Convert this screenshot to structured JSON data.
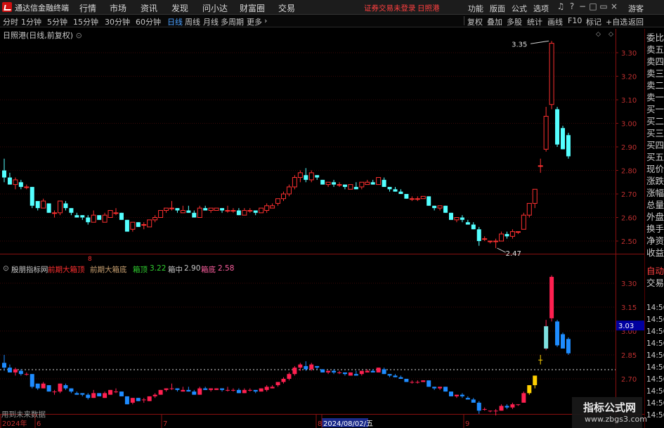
{
  "app": {
    "title": "通达信金融终端",
    "menu": [
      "行情",
      "市场",
      "资讯",
      "发现",
      "问小达",
      "财富圈",
      "交易"
    ],
    "status": "证券交易未登录",
    "stock": "日照港",
    "right_menu": [
      "功能",
      "版面",
      "公式",
      "选项"
    ],
    "guest": "游客"
  },
  "periods": [
    "分时",
    "1分钟",
    "5分钟",
    "15分钟",
    "30分钟",
    "60分钟",
    "日线",
    "周线",
    "月线",
    "多周期",
    "更多"
  ],
  "active_period": "日线",
  "toolbar": [
    "复权",
    "叠加",
    "多股",
    "统计",
    "画线",
    "F10",
    "标记",
    "+自选",
    "返回"
  ],
  "chart_title": "日照港(日线,前复权)",
  "indicator": {
    "name": "殷朋指标网",
    "prev_top_label": "前期大箱顶",
    "prev_bot_label": "前期大箱底",
    "top_label": "箱顶",
    "top_value": "3.22",
    "mid_label": "箱中",
    "mid_value": "2.90",
    "bot_label": "箱底",
    "bot_value": "2.58"
  },
  "right_panel": [
    "委比",
    "卖五",
    "卖四",
    "卖三",
    "卖二",
    "卖一",
    "买一",
    "买二",
    "买三",
    "买四",
    "买五",
    "现价",
    "涨跌",
    "涨幅",
    "总量",
    "外盘",
    "换手",
    "净资",
    "收益",
    "自动",
    "交易",
    "14:56",
    "14:56",
    "14:56",
    "14:56",
    "14:56",
    "14:56",
    "14:56",
    "14:56",
    "14:56",
    "14:56"
  ],
  "price_axis": [
    "3.30",
    "3.20",
    "3.10",
    "3.00",
    "2.90",
    "2.80",
    "2.70",
    "2.60",
    "2.50"
  ],
  "ind_axis": [
    "3.30",
    "3.15",
    "3.00",
    "2.85",
    "2.70"
  ],
  "ind_current": "3.03",
  "high_mark": "3.35",
  "low_mark": "2.47",
  "date_axis": [
    "2024年",
    "6",
    "7",
    "8",
    "2024/08/02/五",
    "9"
  ],
  "date_marker": "8",
  "footnote": "用到未来数据",
  "watermark": [
    "指标公式网",
    "www.zbgs3.com"
  ],
  "colors": {
    "up": "#ff3030",
    "down": "#54ffff",
    "accent": "#4aa0ff",
    "indicator_down": "#1e8cff",
    "indicator_yellow": "#ffd000"
  },
  "chart_data": {
    "type": "candlestick",
    "title": "日照港(日线,前复权)",
    "ylim": [
      2.44,
      3.4
    ],
    "ohlc": [
      [
        2.8,
        2.85,
        2.75,
        2.77
      ],
      [
        2.77,
        2.79,
        2.74,
        2.74
      ],
      [
        2.74,
        2.77,
        2.72,
        2.76
      ],
      [
        2.75,
        2.76,
        2.72,
        2.73
      ],
      [
        2.73,
        2.74,
        2.72,
        2.73
      ],
      [
        2.73,
        2.73,
        2.64,
        2.65
      ],
      [
        2.67,
        2.67,
        2.63,
        2.64
      ],
      [
        2.64,
        2.68,
        2.64,
        2.67
      ],
      [
        2.66,
        2.66,
        2.62,
        2.62
      ],
      [
        2.62,
        2.63,
        2.6,
        2.62
      ],
      [
        2.62,
        2.67,
        2.61,
        2.67
      ],
      [
        2.66,
        2.67,
        2.63,
        2.64
      ],
      [
        2.64,
        2.64,
        2.61,
        2.62
      ],
      [
        2.61,
        2.62,
        2.6,
        2.6
      ],
      [
        2.61,
        2.61,
        2.59,
        2.6
      ],
      [
        2.6,
        2.61,
        2.57,
        2.58
      ],
      [
        2.58,
        2.63,
        2.58,
        2.61
      ],
      [
        2.61,
        2.61,
        2.59,
        2.59
      ],
      [
        2.58,
        2.62,
        2.58,
        2.61
      ],
      [
        2.6,
        2.63,
        2.6,
        2.63
      ],
      [
        2.62,
        2.64,
        2.61,
        2.62
      ],
      [
        2.62,
        2.62,
        2.59,
        2.59
      ],
      [
        2.59,
        2.59,
        2.54,
        2.54
      ],
      [
        2.55,
        2.58,
        2.54,
        2.58
      ],
      [
        2.58,
        2.58,
        2.56,
        2.56
      ],
      [
        2.57,
        2.58,
        2.55,
        2.57
      ],
      [
        2.56,
        2.59,
        2.56,
        2.59
      ],
      [
        2.59,
        2.61,
        2.58,
        2.6
      ],
      [
        2.6,
        2.63,
        2.6,
        2.63
      ],
      [
        2.63,
        2.64,
        2.62,
        2.64
      ],
      [
        2.64,
        2.67,
        2.63,
        2.64
      ],
      [
        2.64,
        2.64,
        2.62,
        2.63
      ],
      [
        2.62,
        2.65,
        2.62,
        2.63
      ],
      [
        2.63,
        2.65,
        2.62,
        2.62
      ],
      [
        2.62,
        2.63,
        2.6,
        2.6
      ],
      [
        2.6,
        2.65,
        2.6,
        2.64
      ],
      [
        2.64,
        2.65,
        2.63,
        2.63
      ],
      [
        2.63,
        2.64,
        2.62,
        2.64
      ],
      [
        2.63,
        2.64,
        2.63,
        2.64
      ],
      [
        2.64,
        2.64,
        2.62,
        2.63
      ],
      [
        2.63,
        2.65,
        2.62,
        2.63
      ],
      [
        2.63,
        2.64,
        2.62,
        2.63
      ],
      [
        2.63,
        2.64,
        2.61,
        2.61
      ],
      [
        2.61,
        2.64,
        2.61,
        2.63
      ],
      [
        2.63,
        2.64,
        2.62,
        2.63
      ],
      [
        2.63,
        2.63,
        2.61,
        2.62
      ],
      [
        2.62,
        2.64,
        2.62,
        2.64
      ],
      [
        2.63,
        2.66,
        2.62,
        2.65
      ],
      [
        2.64,
        2.66,
        2.64,
        2.65
      ],
      [
        2.66,
        2.68,
        2.65,
        2.68
      ],
      [
        2.68,
        2.71,
        2.67,
        2.7
      ],
      [
        2.7,
        2.74,
        2.69,
        2.73
      ],
      [
        2.73,
        2.78,
        2.72,
        2.77
      ],
      [
        2.77,
        2.8,
        2.75,
        2.79
      ],
      [
        2.78,
        2.81,
        2.75,
        2.76
      ],
      [
        2.76,
        2.8,
        2.75,
        2.79
      ],
      [
        2.78,
        2.78,
        2.76,
        2.77
      ],
      [
        2.76,
        2.76,
        2.74,
        2.74
      ],
      [
        2.74,
        2.75,
        2.73,
        2.75
      ],
      [
        2.75,
        2.76,
        2.73,
        2.74
      ],
      [
        2.74,
        2.75,
        2.73,
        2.74
      ],
      [
        2.74,
        2.74,
        2.72,
        2.73
      ],
      [
        2.72,
        2.74,
        2.72,
        2.74
      ],
      [
        2.73,
        2.75,
        2.72,
        2.72
      ],
      [
        2.73,
        2.75,
        2.72,
        2.75
      ],
      [
        2.74,
        2.76,
        2.74,
        2.75
      ],
      [
        2.75,
        2.76,
        2.74,
        2.74
      ],
      [
        2.74,
        2.77,
        2.74,
        2.77
      ],
      [
        2.76,
        2.77,
        2.73,
        2.73
      ],
      [
        2.73,
        2.73,
        2.71,
        2.72
      ],
      [
        2.72,
        2.73,
        2.71,
        2.71
      ],
      [
        2.71,
        2.72,
        2.7,
        2.7
      ],
      [
        2.7,
        2.7,
        2.68,
        2.68
      ],
      [
        2.68,
        2.69,
        2.67,
        2.68
      ],
      [
        2.68,
        2.69,
        2.67,
        2.68
      ],
      [
        2.68,
        2.69,
        2.68,
        2.69
      ],
      [
        2.69,
        2.69,
        2.65,
        2.65
      ],
      [
        2.65,
        2.65,
        2.63,
        2.64
      ],
      [
        2.64,
        2.65,
        2.63,
        2.65
      ],
      [
        2.65,
        2.65,
        2.62,
        2.62
      ],
      [
        2.62,
        2.62,
        2.59,
        2.59
      ],
      [
        2.59,
        2.6,
        2.58,
        2.6
      ],
      [
        2.6,
        2.61,
        2.58,
        2.59
      ],
      [
        2.58,
        2.59,
        2.57,
        2.57
      ],
      [
        2.57,
        2.58,
        2.55,
        2.55
      ],
      [
        2.55,
        2.56,
        2.48,
        2.5
      ],
      [
        2.51,
        2.52,
        2.5,
        2.51
      ],
      [
        2.5,
        2.5,
        2.49,
        2.5
      ],
      [
        2.5,
        2.51,
        2.47,
        2.5
      ],
      [
        2.5,
        2.54,
        2.5,
        2.53
      ],
      [
        2.53,
        2.54,
        2.51,
        2.52
      ],
      [
        2.52,
        2.55,
        2.51,
        2.54
      ],
      [
        2.54,
        2.54,
        2.53,
        2.54
      ],
      [
        2.55,
        2.62,
        2.55,
        2.61
      ],
      [
        2.61,
        2.66,
        2.6,
        2.66
      ],
      [
        2.66,
        2.72,
        2.64,
        2.72
      ],
      [
        2.82,
        2.85,
        2.79,
        2.82
      ],
      [
        2.89,
        3.07,
        2.88,
        3.03
      ],
      [
        3.08,
        3.35,
        3.06,
        3.34
      ],
      [
        3.06,
        3.07,
        2.9,
        2.91
      ],
      [
        2.98,
        2.99,
        2.89,
        2.89
      ],
      [
        2.95,
        2.96,
        2.85,
        2.86
      ]
    ],
    "indicator_levels": {
      "top": 3.22,
      "mid": 2.9,
      "bottom": 2.58
    }
  }
}
